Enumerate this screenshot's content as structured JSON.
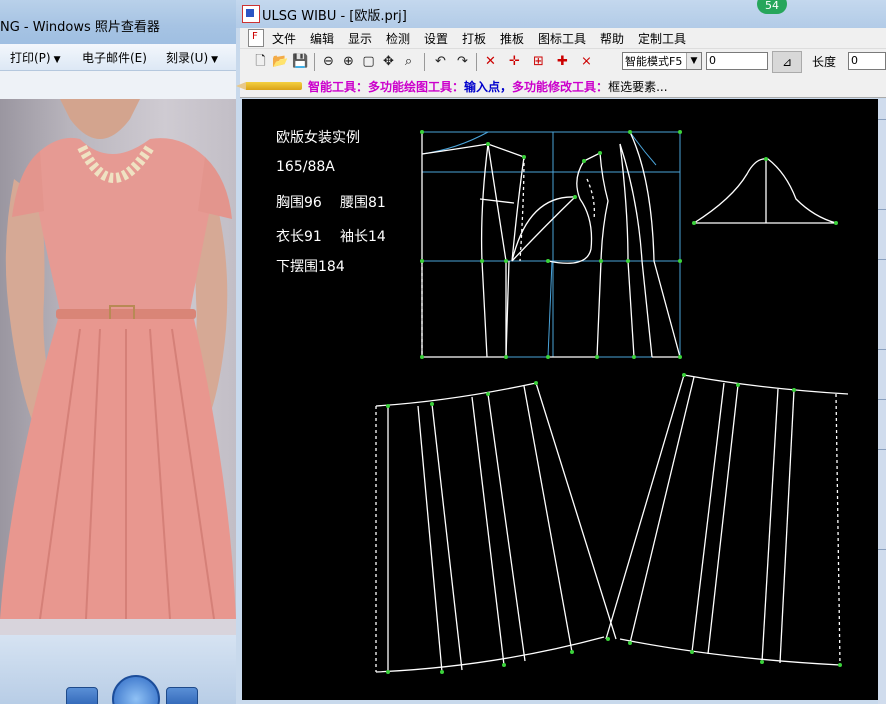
{
  "viewer": {
    "title": "NG - Windows 照片查看器",
    "menu": [
      {
        "label": "打印(P)"
      },
      {
        "label": "电子邮件(E)"
      },
      {
        "label": "刻录(U)"
      }
    ]
  },
  "cad": {
    "title": "ULSG WIBU - [欧版.prj]",
    "badge": "54",
    "menu": [
      "文件",
      "编辑",
      "显示",
      "检测",
      "设置",
      "打板",
      "推板",
      "图标工具",
      "帮助",
      "定制工具"
    ],
    "toolbar": {
      "mode_select": "智能模式F5",
      "value_input": "0",
      "length_label": "长度",
      "length_input": "0"
    },
    "hint": {
      "part1": "智能工具：",
      "part2": "多功能绘图工具：",
      "part3": "输入点，",
      "part4": "多功能修改工具：",
      "part5": "框选要素..."
    },
    "specs": {
      "title": "欧版女装实例",
      "size": "165/88A",
      "chest": "胸围96",
      "waist": "腰围81",
      "length": "衣长91",
      "sleeve": "袖长14",
      "hem": "下摆围184"
    }
  },
  "colors": {
    "canvas_bg": "#000000",
    "pattern_line": "#ffffff",
    "construction_line": "#4aa3d9",
    "point": "#3bd23b",
    "badge": "#26a65b"
  }
}
